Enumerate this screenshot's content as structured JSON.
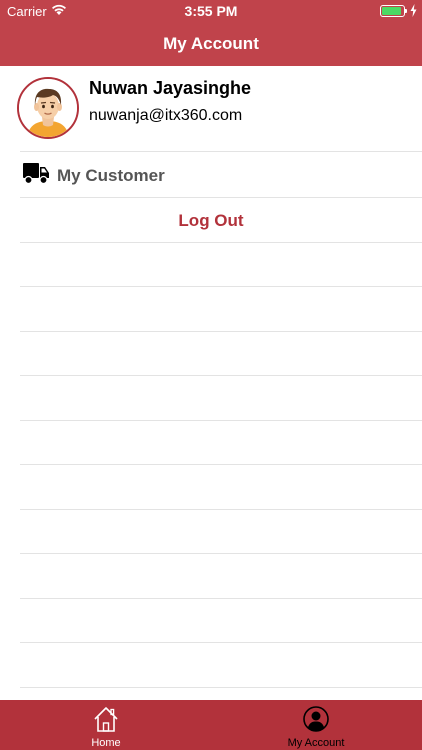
{
  "status_bar": {
    "carrier": "Carrier",
    "time": "3:55 PM",
    "battery_level": 0.9,
    "battery_color": "#4cd964"
  },
  "nav": {
    "title": "My Account"
  },
  "profile": {
    "name": "Nuwan Jayasinghe",
    "email": "nuwanja@itx360.com",
    "avatar_icon": "user-avatar-illustration"
  },
  "menu": {
    "customer": {
      "label": "My Customer",
      "icon": "truck-icon"
    },
    "logout": {
      "label": "Log Out"
    }
  },
  "tab_bar": {
    "home": {
      "label": "Home",
      "icon": "home-icon"
    },
    "account": {
      "label": "My Account",
      "icon": "account-icon",
      "selected": true
    }
  },
  "colors": {
    "primary": "#c0434b",
    "tab_bar": "#b2323b",
    "logout_text": "#b2323b",
    "separator": "#e3e3e3"
  }
}
